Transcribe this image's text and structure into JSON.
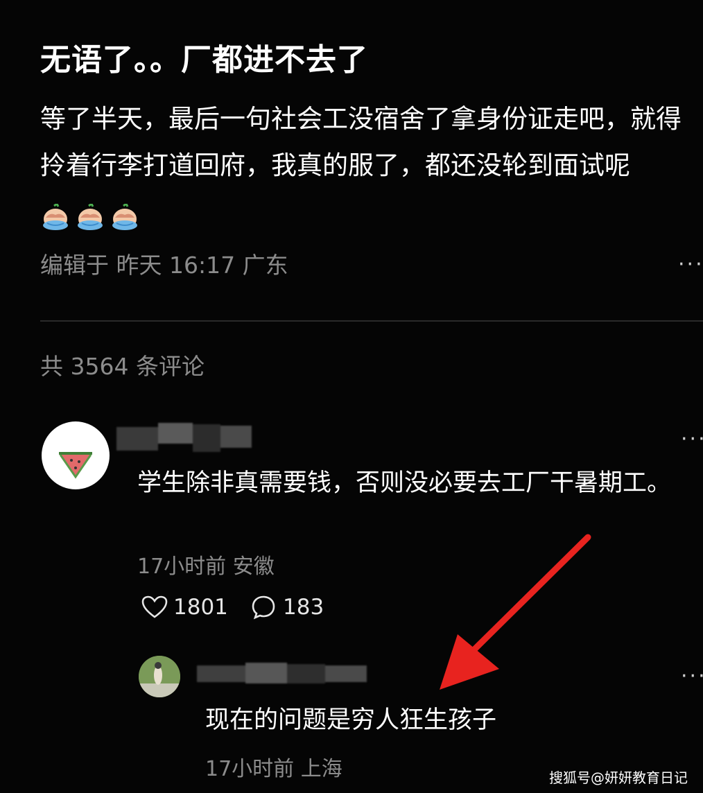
{
  "post": {
    "title": "无语了。。厂都进不去了",
    "body": "等了半天，最后一句社会工没宿舍了拿身份证走吧，就得拎着行李打道回府，我真的服了，都还没轮到面试呢",
    "edited_label": "编辑于",
    "edited_time": "昨天 16:17",
    "location": "广东"
  },
  "comments_header": {
    "label": "共 3564 条评论"
  },
  "comment1": {
    "text": "学生除非真需要钱，否则没必要去工厂干暑期工。",
    "time": "17小时前",
    "location": "安徽",
    "likes": "1801",
    "replies": "183"
  },
  "reply1": {
    "text": "现在的问题是穷人狂生孩子",
    "time": "17小时前",
    "location": "上海"
  },
  "watermark": "搜狐号@妍妍教育日记",
  "colors": {
    "background": "#050505",
    "text_primary": "#ffffff",
    "text_secondary": "#8c8c8c",
    "arrow": "#e8231f"
  },
  "icons": [
    "crying-face-icon",
    "more-icon",
    "heart-icon",
    "comment-icon",
    "watermelon-icon"
  ]
}
